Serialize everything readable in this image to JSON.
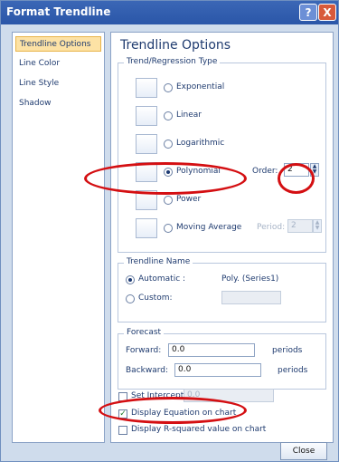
{
  "window": {
    "title": "Format Trendline",
    "help_icon": "?",
    "close_icon": "X"
  },
  "sidebar": {
    "items": [
      {
        "label": "Trendline Options"
      },
      {
        "label": "Line Color"
      },
      {
        "label": "Line Style"
      },
      {
        "label": "Shadow"
      }
    ]
  },
  "panel": {
    "title": "Trendline Options",
    "regression": {
      "label": "Trend/Regression Type",
      "options": [
        {
          "label": "Exponential",
          "selected": false
        },
        {
          "label": "Linear",
          "selected": false
        },
        {
          "label": "Logarithmic",
          "selected": false
        },
        {
          "label": "Polynomial",
          "selected": true
        },
        {
          "label": "Power",
          "selected": false
        },
        {
          "label": "Moving Average",
          "selected": false
        }
      ],
      "order_label": "Order:",
      "order_value": "2",
      "period_label": "Period:",
      "period_value": "2"
    },
    "name": {
      "label": "Trendline Name",
      "automatic_label": "Automatic :",
      "automatic_value": "Poly. (Series1)",
      "custom_label": "Custom:"
    },
    "forecast": {
      "label": "Forecast",
      "forward_label": "Forward:",
      "forward_value": "0.0",
      "backward_label": "Backward:",
      "backward_value": "0.0",
      "unit": "periods"
    },
    "set_intercept_label": "Set Intercept =",
    "set_intercept_value": "0.0",
    "display_equation_label": "Display Equation on chart",
    "display_rsq_label": "Display R-squared value on chart",
    "close_label": "Close"
  },
  "colors": {
    "titlebar": "#2a56a8",
    "annotation": "#d40f12",
    "selected_nav": "#fde2a5"
  }
}
